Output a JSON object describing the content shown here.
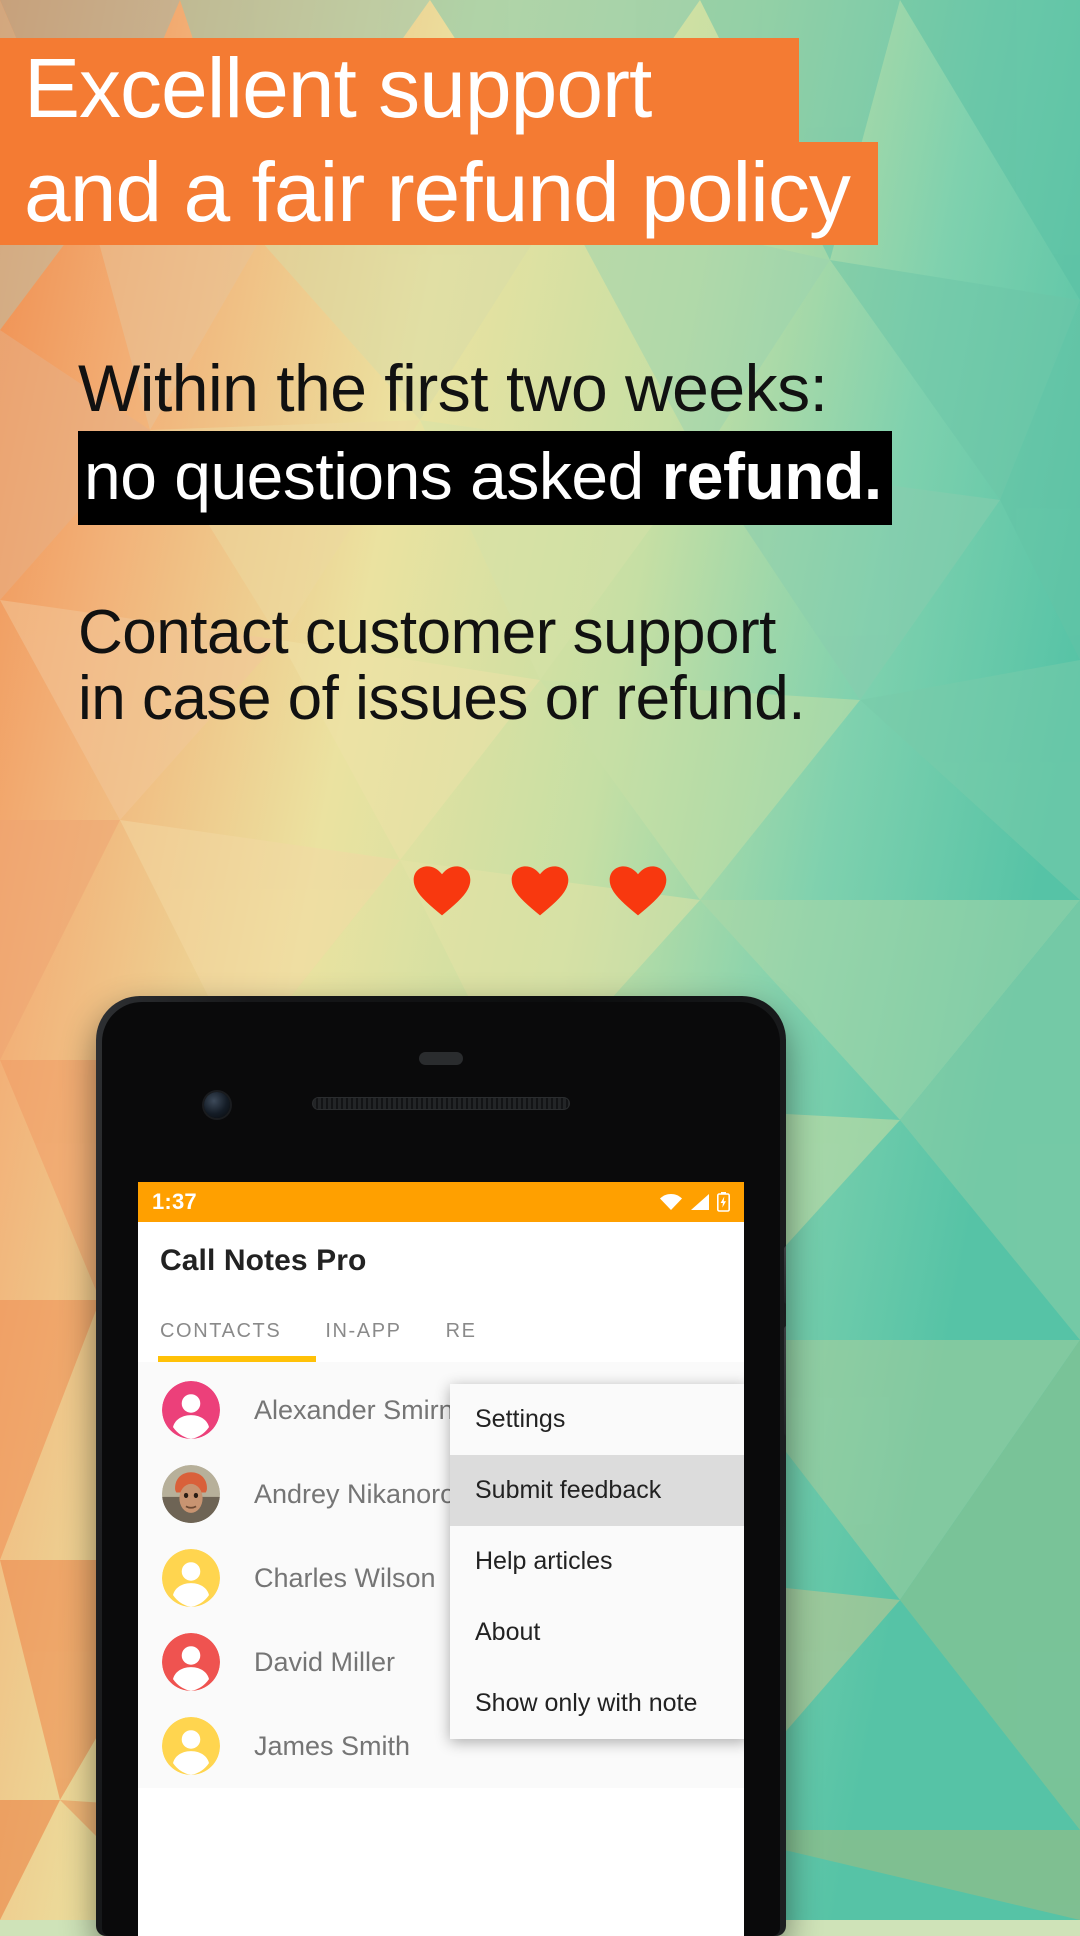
{
  "promo": {
    "headline": {
      "line1": "Excellent support",
      "line2": "and a fair refund policy",
      "bg_color": "#F47B33",
      "text_color": "#FFFFFF"
    },
    "block2": {
      "line1": "Within the first two weeks:",
      "line2_plain": "no questions asked ",
      "line2_bold": "refund.",
      "highlight_bg": "#000000",
      "highlight_text": "#FFFFFF"
    },
    "block3": {
      "line1": "Contact customer support",
      "line2": "in case of issues or refund."
    },
    "hearts": {
      "count": 3,
      "icon": "heart-icon",
      "color": "#F8380F"
    }
  },
  "phone": {
    "statusbar": {
      "time": "1:37",
      "bg_color": "#FFA000",
      "icons": [
        "wifi-icon",
        "signal-icon",
        "battery-icon"
      ]
    },
    "appbar": {
      "title": "Call Notes Pro"
    },
    "tabs": [
      {
        "label": "CONTACTS",
        "active": true
      },
      {
        "label": "IN-APP",
        "active": false
      },
      {
        "label": "RE",
        "active": false
      }
    ],
    "tab_indicator_color": "#FFC107",
    "contacts": [
      {
        "name": "Alexander Smirnov",
        "avatar_type": "letter",
        "avatar_color": "#EC407A"
      },
      {
        "name": "Andrey Nikanorov",
        "avatar_type": "photo",
        "avatar_color": "#8D6E63"
      },
      {
        "name": "Charles Wilson",
        "avatar_type": "letter",
        "avatar_color": "#FFD54F"
      },
      {
        "name": "David Miller",
        "avatar_type": "letter",
        "avatar_color": "#EF5350"
      },
      {
        "name": "James Smith",
        "avatar_type": "letter",
        "avatar_color": "#FFD54F"
      }
    ],
    "overflow_menu": [
      {
        "label": "Settings",
        "highlighted": false
      },
      {
        "label": "Submit feedback",
        "highlighted": true
      },
      {
        "label": "Help articles",
        "highlighted": false
      },
      {
        "label": "About",
        "highlighted": false
      },
      {
        "label": "Show only with note",
        "highlighted": false
      }
    ]
  }
}
